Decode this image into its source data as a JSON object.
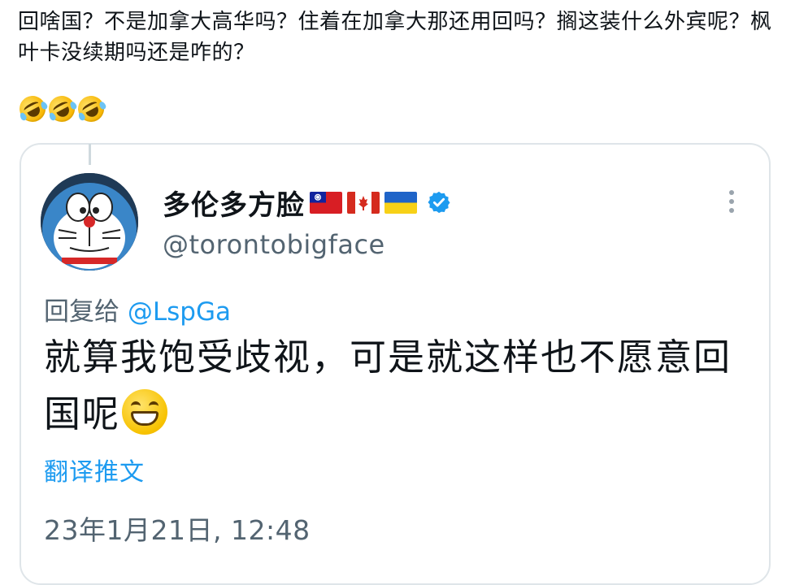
{
  "post": {
    "text": "回啥国？不是加拿大高华吗？住着在加拿大那还用回吗？搁这装什么外宾呢？枫叶卡没续期吗还是咋的？",
    "emoji": [
      "rolling-on-floor-laughing-emoji",
      "rolling-on-floor-laughing-emoji",
      "rolling-on-floor-laughing-emoji"
    ]
  },
  "quoted_tweet": {
    "display_name": "多伦多方脸",
    "flags": [
      "taiwan-flag",
      "canada-flag",
      "ukraine-flag"
    ],
    "verified_icon": "verified-badge-icon",
    "handle": "@torontobigface",
    "reply_prefix": "回复给 ",
    "reply_mention": "@LspGa",
    "body": "就算我饱受歧视，可是就这样也不愿意回国呢",
    "body_emoji": "grinning-face-emoji",
    "translate_label": "翻译推文",
    "timestamp": "23年1月21日, 12:48",
    "more_icon": "more-options-icon"
  },
  "colors": {
    "link": "#1d9bf0",
    "secondary_text": "#536471",
    "border": "#dfe5e9",
    "verified": "#1d9bf0"
  }
}
